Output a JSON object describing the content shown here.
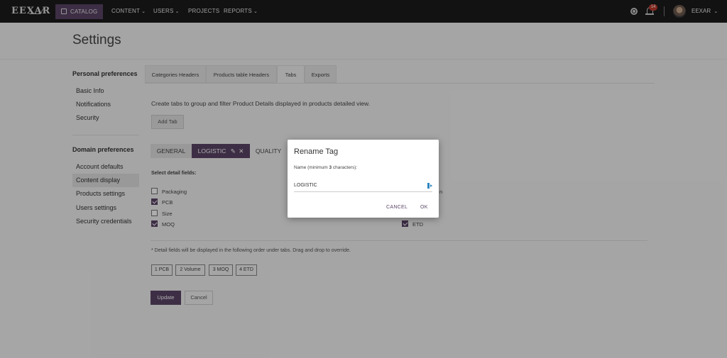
{
  "nav": {
    "logo": "EEXAR",
    "items": [
      {
        "label": "CATALOG",
        "active": true
      },
      {
        "label": "CONTENT",
        "caret": true
      },
      {
        "label": "USERS",
        "caret": true
      },
      {
        "label": "PROJECTS",
        "caret": false
      },
      {
        "label": "REPORTS",
        "caret": true
      }
    ],
    "notifications_count": "14",
    "user_name": "EEXAR",
    "icons": {
      "settings": "gear-icon",
      "notifications": "bell-icon",
      "user_menu": "chevron-down-icon"
    }
  },
  "page": {
    "title": "Settings"
  },
  "sidebar": {
    "personal_heading": "Personal preferences",
    "personal_items": [
      "Basic Info",
      "Notifications",
      "Security"
    ],
    "domain_heading": "Domain preferences",
    "domain_items": [
      "Account defaults",
      "Content display",
      "Products settings",
      "Users settings",
      "Security credentials"
    ],
    "active_item": "Content display"
  },
  "tabs": [
    {
      "label": "Categories Headers"
    },
    {
      "label": "Products table Headers"
    },
    {
      "label": "Tabs",
      "active": true
    },
    {
      "label": "Exports"
    }
  ],
  "content": {
    "intro": "Create tabs to group and filter Product Details displayed in products detailed view.",
    "add_tab_label": "Add Tab",
    "group_tabs": {
      "general": "GENERAL",
      "logistic": "LOGISTIC",
      "quality": "QUALITY"
    },
    "select_label": "Select detail fields:",
    "fields": [
      {
        "label": "Packaging",
        "checked": false
      },
      {
        "label": "PCB",
        "checked": true
      },
      {
        "label": "Size",
        "checked": false
      },
      {
        "label": "MOQ",
        "checked": true
      }
    ],
    "right_fields": [
      {
        "label": "n",
        "partial": true
      },
      {
        "label": "ETD",
        "checked": true
      }
    ],
    "order_note": "* Detail fields will be displayed in the following order under tabs. Drag and drop to override.",
    "order_chips": [
      "1 PCB",
      "2 Volume",
      "3 MOQ",
      "4 ETD"
    ],
    "update_label": "Update",
    "cancel_label": "Cancel"
  },
  "dialog": {
    "title": "Rename Tag",
    "label_prefix": "Name (minimum ",
    "label_min": "3",
    "label_suffix": " characters):",
    "input_value": "LOGISTIC",
    "cancel_label": "CANCEL",
    "ok_label": "OK"
  },
  "colors": {
    "accent": "#5b4566",
    "nav_bg": "#1b1b1b",
    "badge": "#c0392b"
  }
}
